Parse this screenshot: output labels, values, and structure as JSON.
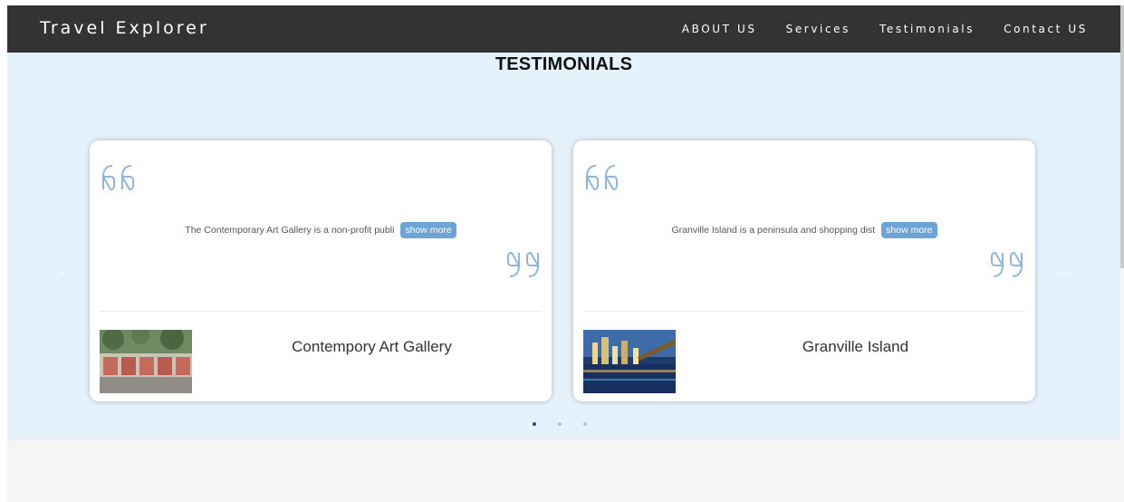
{
  "navbar": {
    "brand": "Travel Explorer",
    "links": [
      "ABOUT US",
      "Services",
      "Testimonials",
      "Contact US"
    ]
  },
  "section": {
    "title": "TESTIMONIALS"
  },
  "cards": [
    {
      "excerpt": "The Contemporary Art Gallery is a non-profit publi",
      "show_more": "show more",
      "name": "Contempory Art Gallery",
      "image_icon": "gallery-photo"
    },
    {
      "excerpt": "Granville Island is a peninsula and shopping dist",
      "show_more": "show more",
      "name": "Granville Island",
      "image_icon": "city-night-photo"
    }
  ],
  "carousel": {
    "prev_icon": "arrow-left-icon",
    "next_icon": "arrow-right-icon",
    "indicator_count": 3,
    "active_index": 0
  },
  "colors": {
    "navbar_bg": "#333333",
    "section_bg": "#e5f2fc",
    "accent": "#6ea3d6",
    "quote": "#8fb6de"
  }
}
